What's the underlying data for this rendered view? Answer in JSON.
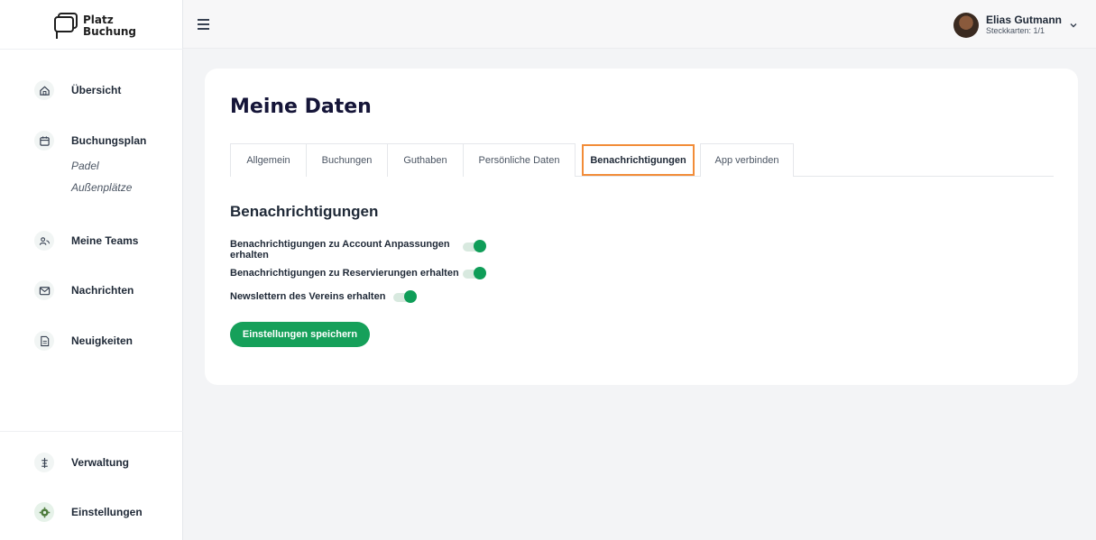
{
  "app": {
    "logo_line1": "Platz",
    "logo_line2": "Buchung"
  },
  "sidebar": {
    "items": [
      {
        "label": "Übersicht",
        "icon": "home-icon"
      },
      {
        "label": "Buchungsplan",
        "icon": "calendar-icon",
        "subitems": [
          "Padel",
          "Außenplätze"
        ]
      },
      {
        "label": "Meine Teams",
        "icon": "team-icon"
      },
      {
        "label": "Nachrichten",
        "icon": "mail-icon"
      },
      {
        "label": "Neuigkeiten",
        "icon": "document-icon"
      }
    ],
    "bottom": [
      {
        "label": "Verwaltung",
        "icon": "sliders-icon"
      },
      {
        "label": "Einstellungen",
        "icon": "gear-icon"
      }
    ]
  },
  "topbar": {
    "menu_icon": "hamburger-icon",
    "user_name": "Elias Gutmann",
    "user_sub": "Steckkarten: 1/1"
  },
  "main": {
    "title": "Meine Daten",
    "tabs": [
      {
        "label": "Allgemein"
      },
      {
        "label": "Buchungen"
      },
      {
        "label": "Guthaben"
      },
      {
        "label": "Persönliche Daten"
      },
      {
        "label": "Benachrichtigungen",
        "active": true
      },
      {
        "label": "App verbinden"
      }
    ],
    "section_title": "Benachrichtigungen",
    "preferences": [
      {
        "label_line1": "Benachrichtigungen zu Account Anpassungen",
        "label_line2": "erhalten",
        "enabled": true
      },
      {
        "label_line1": "Benachrichtigungen zu Reservierungen erhalten",
        "enabled": true
      },
      {
        "label_line1": "Newslettern des Vereins erhalten",
        "enabled": true
      }
    ],
    "save_label": "Einstellungen speichern"
  },
  "colors": {
    "accent_green": "#16a05a",
    "active_tab_border": "#f28c38",
    "title_navy": "#151538"
  }
}
